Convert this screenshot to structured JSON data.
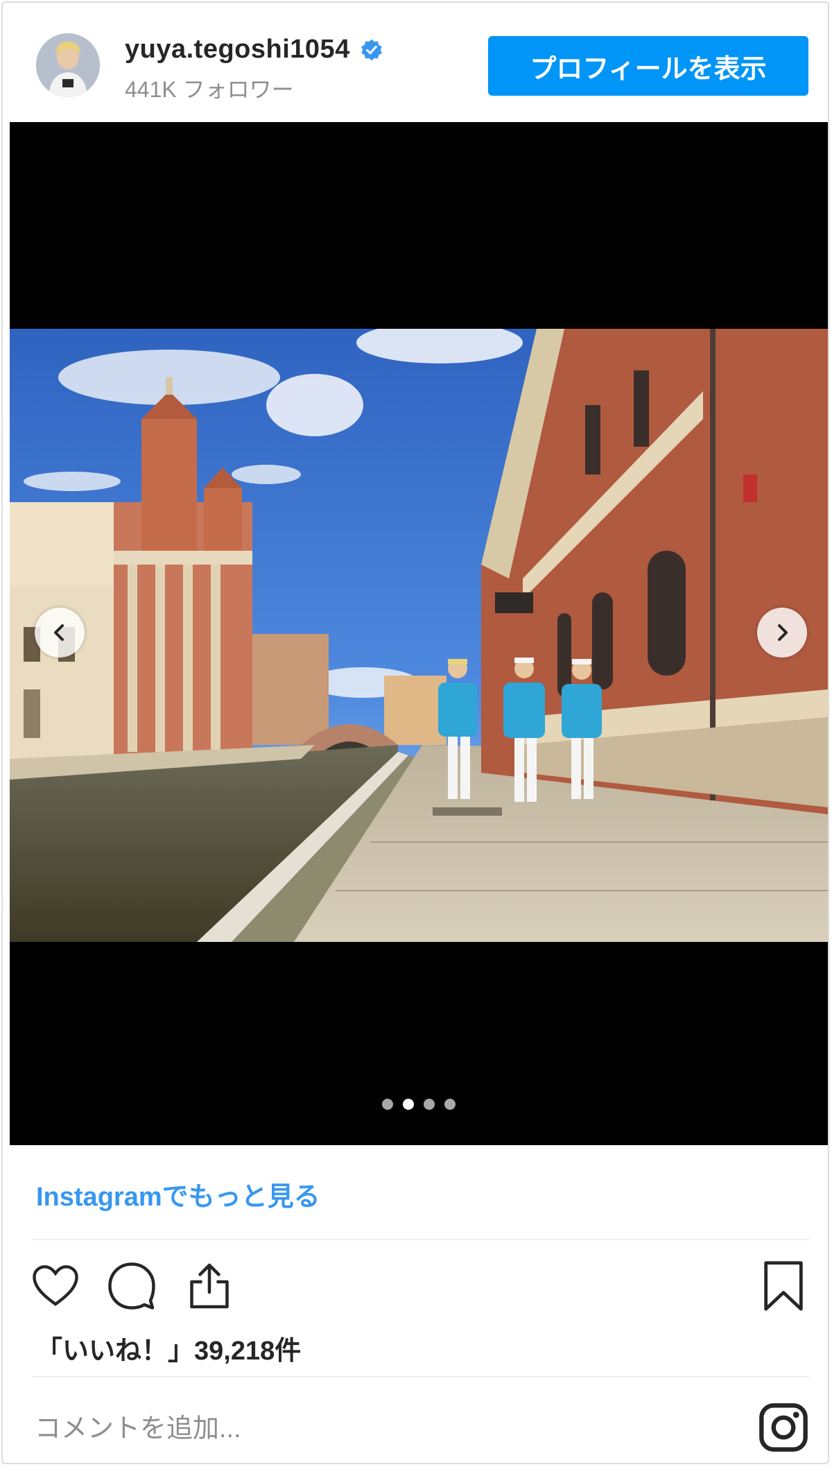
{
  "header": {
    "username": "yuya.tegoshi1054",
    "followers": "441K フォロワー",
    "profile_button": "プロフィールを表示",
    "verified": true
  },
  "carousel": {
    "total_slides": 4,
    "active_slide": 2
  },
  "more_link": "Instagramでもっと見る",
  "likes": "「いいね！」39,218件",
  "comment": {
    "placeholder": "コメントを追加...",
    "value": ""
  },
  "icons": {
    "verified": "verified-badge-icon",
    "prev": "chevron-left-icon",
    "next": "chevron-right-icon",
    "like": "heart-icon",
    "comment": "comment-bubble-icon",
    "share": "share-icon",
    "save": "bookmark-icon",
    "instagram": "instagram-logo-icon"
  },
  "colors": {
    "primary_button": "#0095f6",
    "link": "#3897f0",
    "verified": "#3897f0",
    "secondary_text": "#8e8e8e"
  }
}
